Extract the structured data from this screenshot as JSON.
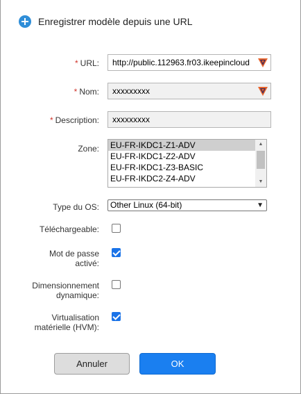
{
  "dialog": {
    "title": "Enregistrer modèle depuis une URL",
    "title_icon": "add-circle-icon",
    "accent_color": "#2f8ed8"
  },
  "form": {
    "required_marker": "*",
    "url": {
      "label": "URL:",
      "value": "http://public.112963.fr03.ikeepincloud"
    },
    "name": {
      "label": "Nom:",
      "value": "xxxxxxxxx"
    },
    "description": {
      "label": "Description:",
      "value": "xxxxxxxxx"
    },
    "zone": {
      "label": "Zone:",
      "options": [
        "EU-FR-IKDC1-Z1-ADV",
        "EU-FR-IKDC1-Z2-ADV",
        "EU-FR-IKDC1-Z3-BASIC",
        "EU-FR-IKDC2-Z4-ADV"
      ],
      "selected": "EU-FR-IKDC1-Z1-ADV"
    },
    "os_type": {
      "label": "Type du OS:",
      "value": "Other Linux (64-bit)"
    },
    "downloadable": {
      "label": "Téléchargeable:",
      "checked": false
    },
    "password_enabled": {
      "label_line1": "Mot de passe",
      "label_line2": "activé:",
      "checked": true
    },
    "dynamic_scaling": {
      "label_line1": "Dimensionnement",
      "label_line2": "dynamique:",
      "checked": false
    },
    "hvm": {
      "label_line1": "Virtualisation",
      "label_line2": "matérielle (HVM):",
      "checked": true
    }
  },
  "buttons": {
    "cancel": "Annuler",
    "ok": "OK"
  },
  "colors": {
    "required": "#d0352c",
    "ok_button": "#1a7ff0",
    "checkbox_checked": "#1a73e8"
  }
}
